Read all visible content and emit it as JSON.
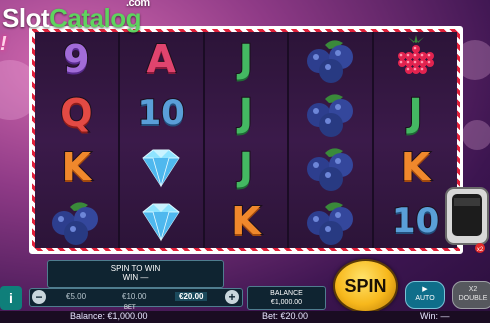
{
  "watermark": {
    "slot": "Slot",
    "catalog": "Catalog",
    "com": ".com"
  },
  "logo_fragment": "!",
  "reels": [
    [
      "9",
      "Q",
      "K",
      "blueberry"
    ],
    [
      "A",
      "10",
      "diamond",
      "diamond"
    ],
    [
      "J",
      "J",
      "J",
      "K"
    ],
    [
      "blueberry",
      "blueberry",
      "blueberry",
      "blueberry"
    ],
    [
      "raspberry",
      "J",
      "K",
      "10"
    ]
  ],
  "info_button": {
    "label": "i",
    "icon": "info-icon"
  },
  "win_panel": {
    "line1": "SPIN TO WIN",
    "line2": "WIN —"
  },
  "bet": {
    "minus": "−",
    "plus": "+",
    "values": [
      "€5.00",
      "€10.00",
      "€20.00"
    ],
    "selected_index": 2,
    "label": "BET"
  },
  "balance": {
    "label": "BALANCE",
    "value": "€1,000.00"
  },
  "spin_button": {
    "label": "SPIN"
  },
  "auto_button": {
    "label": "AUTO",
    "icon": "play-icon"
  },
  "double_button": {
    "line1": "X2",
    "line2": "DOUBLE"
  },
  "status": {
    "balance": "Balance: €1,000.00",
    "bet": "Bet: €20.00",
    "win": "Win: —"
  },
  "colors": {
    "accent": "#f7b81c",
    "panel": "#0f2431",
    "frame_red": "#e0203a"
  }
}
